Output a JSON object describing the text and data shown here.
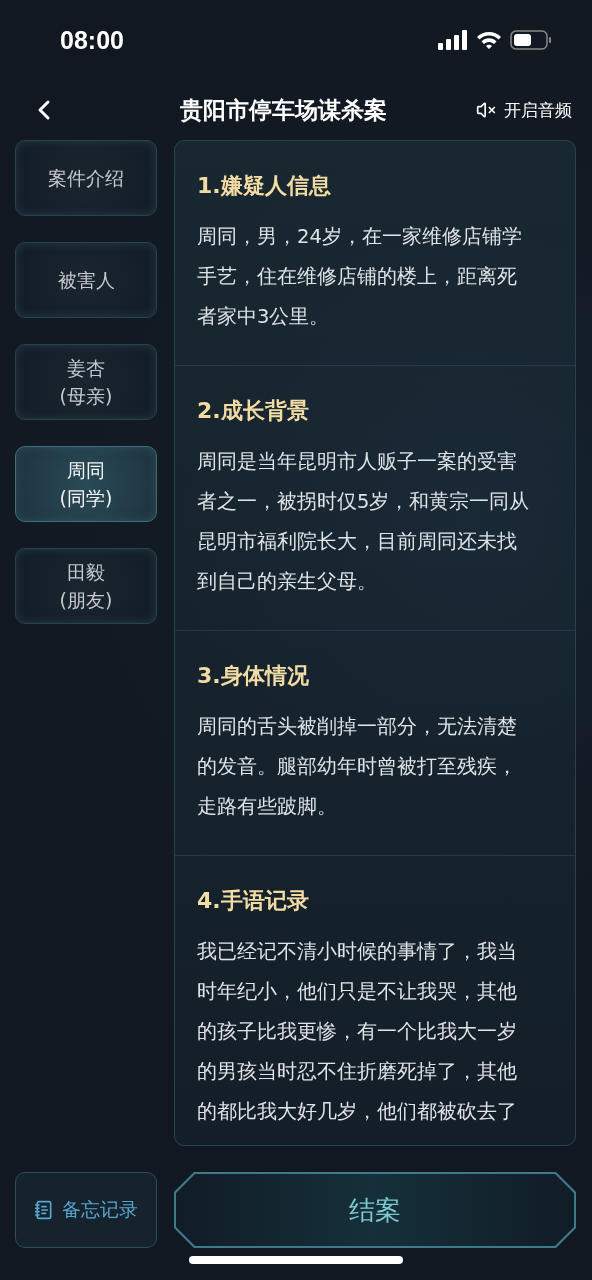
{
  "status_bar": {
    "time": "08:00"
  },
  "header": {
    "title": "贵阳市停车场谋杀案",
    "audio_label": "开启音频",
    "audio_muted": true
  },
  "sidebar": {
    "items": [
      {
        "label": "案件介绍",
        "selected": false
      },
      {
        "label": "被害人",
        "selected": false
      },
      {
        "label": "姜杏",
        "sub": "(母亲)",
        "selected": false
      },
      {
        "label": "周同",
        "sub": "(同学)",
        "selected": true
      },
      {
        "label": "田毅",
        "sub": "(朋友)",
        "selected": false
      }
    ]
  },
  "sections": [
    {
      "heading": "1.嫌疑人信息",
      "lines": [
        "周同，男，24岁，在一家维修店铺学",
        "手艺，住在维修店铺的楼上，距离死",
        "者家中3公里。"
      ]
    },
    {
      "heading": "2.成长背景",
      "lines": [
        "周同是当年昆明市人贩子一案的受害",
        "者之一，被拐时仅5岁，和黄宗一同从",
        "昆明市福利院长大，目前周同还未找",
        "到自己的亲生父母。"
      ]
    },
    {
      "heading": "3.身体情况",
      "lines": [
        "周同的舌头被削掉一部分，无法清楚",
        "的发音。腿部幼年时曾被打至残疾，",
        "走路有些跛脚。"
      ]
    },
    {
      "heading": "4.手语记录",
      "lines": [
        "我已经记不清小时候的事情了，我当",
        "时年纪小，他们只是不让我哭，其他",
        "的孩子比我更惨，有一个比我大一岁",
        "的男孩当时忍不住折磨死掉了，其他",
        "的都比我大好几岁，他们都被砍去了"
      ]
    }
  ],
  "footer": {
    "memo_label": "备忘记录",
    "close_label": "结案"
  }
}
